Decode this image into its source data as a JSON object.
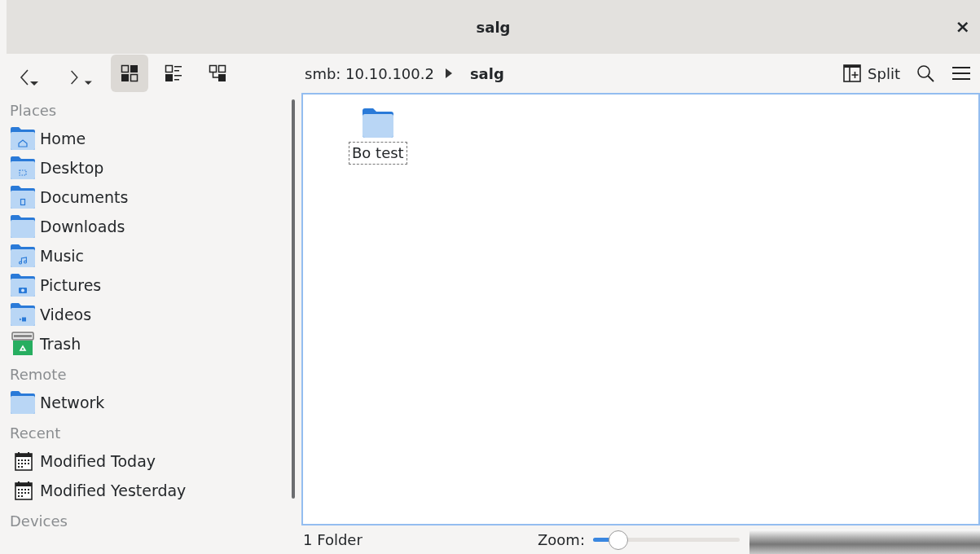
{
  "window": {
    "title": "salg",
    "close": "×"
  },
  "toolbar": {
    "view_modes": [
      {
        "kind": "icons",
        "selected": true
      },
      {
        "kind": "details",
        "selected": false
      },
      {
        "kind": "tree",
        "selected": false
      }
    ],
    "breadcrumb": [
      {
        "label": "smb: 10.10.100.2",
        "current": false
      },
      {
        "label": "salg",
        "current": true
      }
    ],
    "split": "Split"
  },
  "sidebar": {
    "sections": [
      {
        "title": "Places",
        "items": [
          {
            "label": "Home",
            "kind": "home"
          },
          {
            "label": "Desktop",
            "kind": "desktop"
          },
          {
            "label": "Documents",
            "kind": "documents"
          },
          {
            "label": "Downloads",
            "kind": "folder"
          },
          {
            "label": "Music",
            "kind": "music"
          },
          {
            "label": "Pictures",
            "kind": "pictures"
          },
          {
            "label": "Videos",
            "kind": "videos"
          },
          {
            "label": "Trash",
            "kind": "trash"
          }
        ]
      },
      {
        "title": "Remote",
        "items": [
          {
            "label": "Network",
            "kind": "folder"
          }
        ]
      },
      {
        "title": "Recent",
        "items": [
          {
            "label": "Modified Today",
            "kind": "calendar"
          },
          {
            "label": "Modified Yesterday",
            "kind": "calendar"
          }
        ]
      },
      {
        "title": "Devices"
      }
    ]
  },
  "files": [
    {
      "name": "Bo test",
      "focused": true
    }
  ],
  "status_bar": {
    "summary": "1 Folder",
    "zoom_label": "Zoom:",
    "zoom": {
      "level": 0.17
    }
  }
}
